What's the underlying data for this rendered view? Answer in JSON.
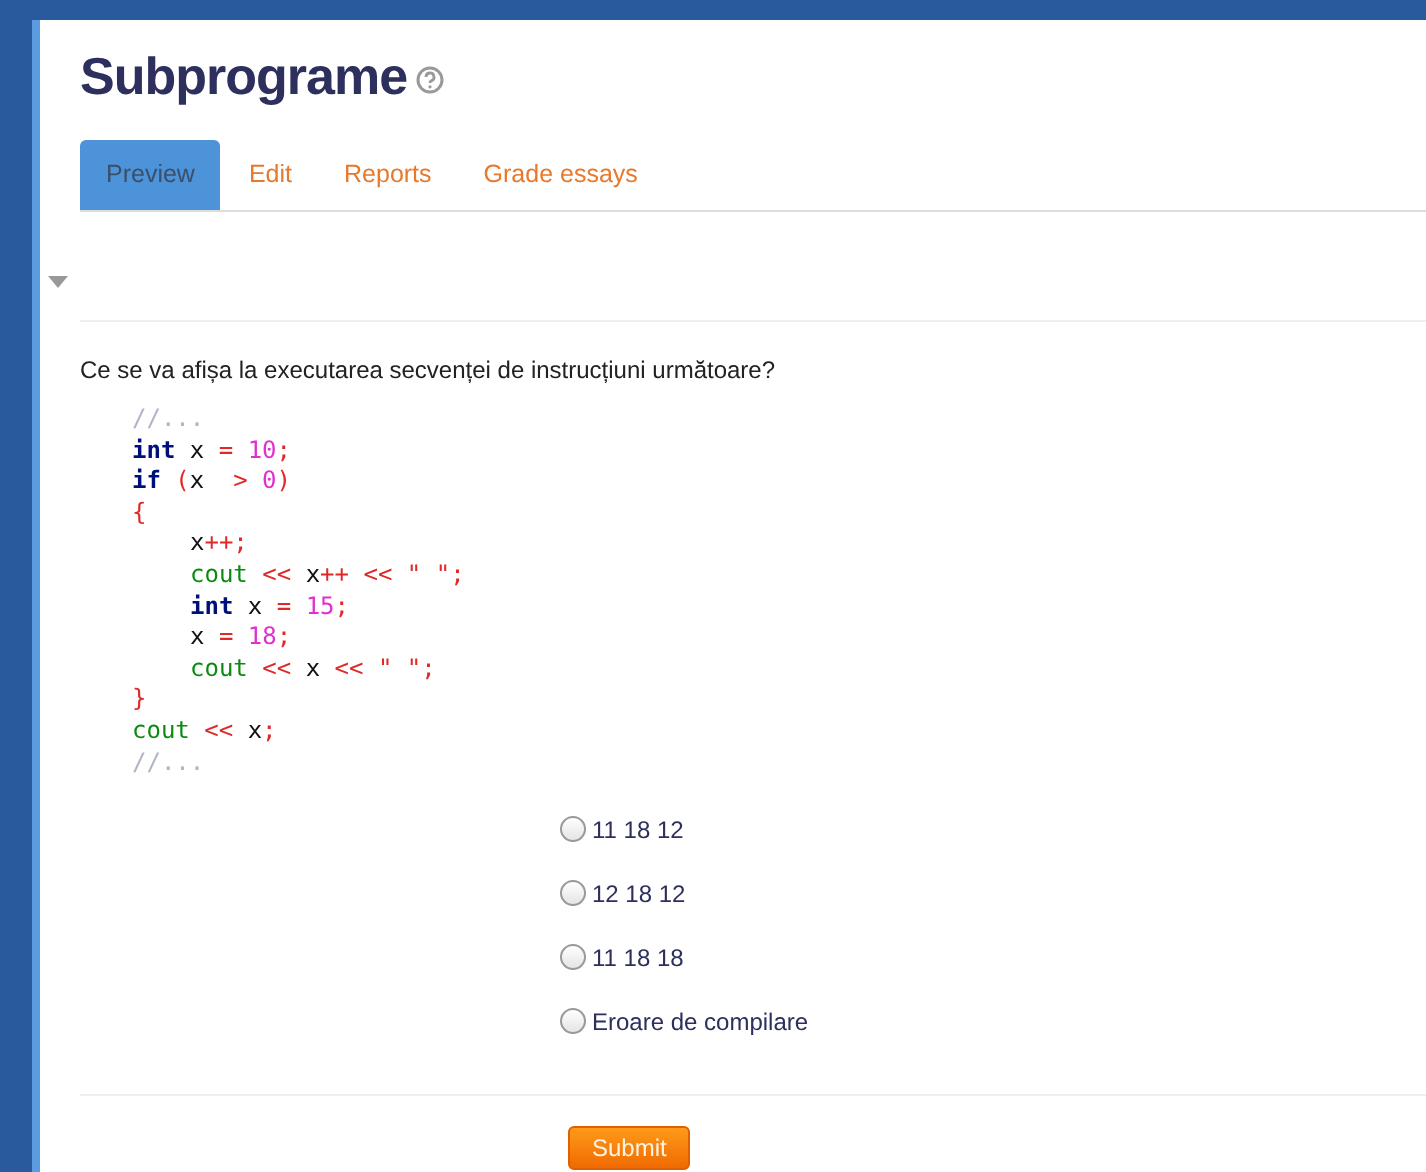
{
  "title": "Subprograme",
  "tabs": [
    {
      "label": "Preview",
      "selected": true
    },
    {
      "label": "Edit",
      "selected": false
    },
    {
      "label": "Reports",
      "selected": false
    },
    {
      "label": "Grade essays",
      "selected": false
    }
  ],
  "question": "Ce se va afișa la executarea secvenței de instrucțiuni următoare?",
  "code": [
    {
      "indented": false,
      "tokens": [
        {
          "kind": "comment",
          "text": "//..."
        }
      ]
    },
    {
      "indented": false,
      "tokens": [
        {
          "kind": "keyword",
          "text": "int"
        },
        {
          "kind": "plain",
          "text": " x "
        },
        {
          "kind": "operator",
          "text": "="
        },
        {
          "kind": "number",
          "text": " 10"
        },
        {
          "kind": "operator",
          "text": ";"
        }
      ]
    },
    {
      "indented": false,
      "tokens": [
        {
          "kind": "keyword",
          "text": "if"
        },
        {
          "kind": "operator",
          "text": " ("
        },
        {
          "kind": "plain",
          "text": "x  "
        },
        {
          "kind": "operator",
          "text": ">"
        },
        {
          "kind": "number",
          "text": " 0"
        },
        {
          "kind": "operator",
          "text": ")"
        }
      ]
    },
    {
      "indented": false,
      "tokens": [
        {
          "kind": "operator",
          "text": "{"
        }
      ]
    },
    {
      "indented": true,
      "tokens": [
        {
          "kind": "plain",
          "text": "x"
        },
        {
          "kind": "operator",
          "text": "++;"
        }
      ]
    },
    {
      "indented": true,
      "tokens": [
        {
          "kind": "stream",
          "text": "cout"
        },
        {
          "kind": "operator",
          "text": " << "
        },
        {
          "kind": "plain",
          "text": "x"
        },
        {
          "kind": "operator",
          "text": "++ << \" \";"
        }
      ]
    },
    {
      "indented": true,
      "tokens": [
        {
          "kind": "keyword",
          "text": "int"
        },
        {
          "kind": "plain",
          "text": " x "
        },
        {
          "kind": "operator",
          "text": "="
        },
        {
          "kind": "number",
          "text": " 15"
        },
        {
          "kind": "operator",
          "text": ";"
        }
      ]
    },
    {
      "indented": true,
      "tokens": [
        {
          "kind": "plain",
          "text": "x "
        },
        {
          "kind": "operator",
          "text": "="
        },
        {
          "kind": "number",
          "text": " 18"
        },
        {
          "kind": "operator",
          "text": ";"
        }
      ]
    },
    {
      "indented": true,
      "tokens": [
        {
          "kind": "stream",
          "text": "cout"
        },
        {
          "kind": "operator",
          "text": " << "
        },
        {
          "kind": "plain",
          "text": "x "
        },
        {
          "kind": "operator",
          "text": "<< \" \";"
        }
      ]
    },
    {
      "indented": false,
      "tokens": [
        {
          "kind": "operator",
          "text": "}"
        }
      ]
    },
    {
      "indented": false,
      "tokens": [
        {
          "kind": "stream",
          "text": "cout"
        },
        {
          "kind": "operator",
          "text": " << "
        },
        {
          "kind": "plain",
          "text": "x"
        },
        {
          "kind": "operator",
          "text": ";"
        }
      ]
    },
    {
      "indented": false,
      "tokens": [
        {
          "kind": "comment",
          "text": "//..."
        }
      ]
    }
  ],
  "options": [
    {
      "label": "11 18 12",
      "selected": false
    },
    {
      "label": "12 18 12",
      "selected": false
    },
    {
      "label": "11 18 18",
      "selected": false
    },
    {
      "label": "Eroare de compilare",
      "selected": false
    }
  ],
  "submit": "Submit"
}
